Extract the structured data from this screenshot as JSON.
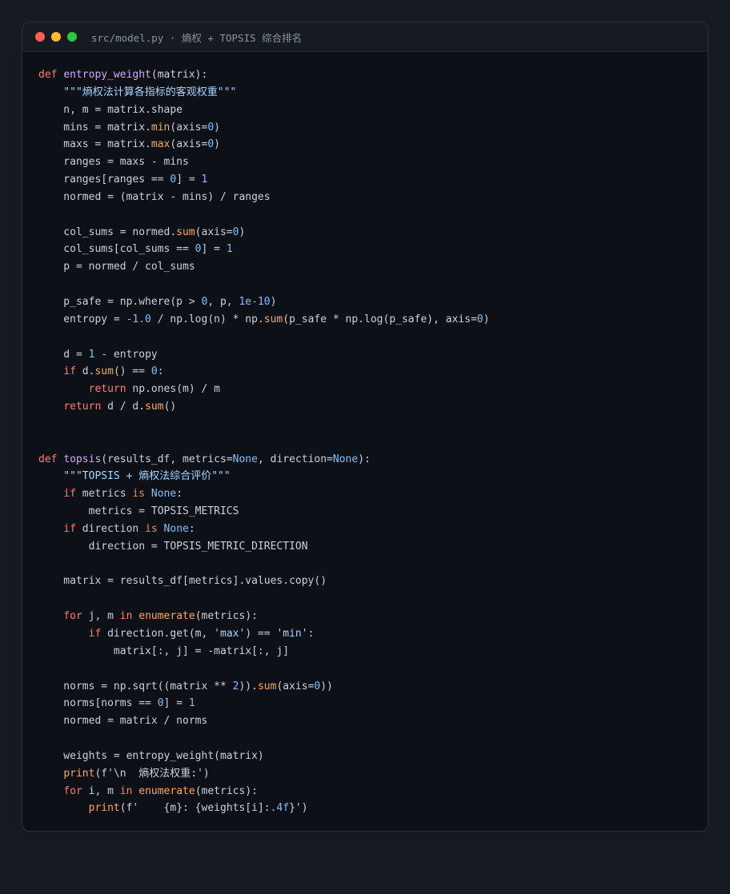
{
  "window": {
    "title": "src/model.py · 熵权 + TOPSIS 综合排名"
  },
  "colors": {
    "keyword": "#ff7b72",
    "function_name": "#d2a8ff",
    "builtin": "#ffa657",
    "number": "#79c0ff",
    "string": "#a5d6ff",
    "text": "#c9d1d9",
    "background": "#0d1117"
  },
  "code": {
    "lines": [
      [
        [
          "kw",
          "def "
        ],
        [
          "fn",
          "entropy_weight"
        ],
        [
          "t",
          "(matrix):"
        ]
      ],
      [
        [
          "str",
          "    \"\"\"熵权法计算各指标的客观权重\"\"\""
        ]
      ],
      [
        [
          "t",
          "    n, m = matrix.shape"
        ]
      ],
      [
        [
          "t",
          "    mins = matrix."
        ],
        [
          "bi",
          "min"
        ],
        [
          "t",
          "(axis="
        ],
        [
          "num",
          "0"
        ],
        [
          "t",
          ")"
        ]
      ],
      [
        [
          "t",
          "    maxs = matrix."
        ],
        [
          "bi",
          "max"
        ],
        [
          "t",
          "(axis="
        ],
        [
          "num",
          "0"
        ],
        [
          "t",
          ")"
        ]
      ],
      [
        [
          "t",
          "    ranges = maxs - mins"
        ]
      ],
      [
        [
          "t",
          "    ranges[ranges == "
        ],
        [
          "num",
          "0"
        ],
        [
          "t",
          "] = "
        ],
        [
          "num",
          "1"
        ]
      ],
      [
        [
          "t",
          "    normed = (matrix - mins) / ranges"
        ]
      ],
      [
        [
          "t",
          ""
        ]
      ],
      [
        [
          "t",
          "    col_sums = normed."
        ],
        [
          "bi",
          "sum"
        ],
        [
          "t",
          "(axis="
        ],
        [
          "num",
          "0"
        ],
        [
          "t",
          ")"
        ]
      ],
      [
        [
          "t",
          "    col_sums[col_sums == "
        ],
        [
          "num",
          "0"
        ],
        [
          "t",
          "] = "
        ],
        [
          "num",
          "1"
        ]
      ],
      [
        [
          "t",
          "    p = normed / col_sums"
        ]
      ],
      [
        [
          "t",
          ""
        ]
      ],
      [
        [
          "t",
          "    p_safe = np.where(p > "
        ],
        [
          "num",
          "0"
        ],
        [
          "t",
          ", p, "
        ],
        [
          "num",
          "1e-10"
        ],
        [
          "t",
          ")"
        ]
      ],
      [
        [
          "t",
          "    entropy = "
        ],
        [
          "num",
          "-1.0"
        ],
        [
          "t",
          " / np.log(n) * np."
        ],
        [
          "bi",
          "sum"
        ],
        [
          "t",
          "(p_safe * np.log(p_safe), axis="
        ],
        [
          "num",
          "0"
        ],
        [
          "t",
          ")"
        ]
      ],
      [
        [
          "t",
          ""
        ]
      ],
      [
        [
          "t",
          "    d = "
        ],
        [
          "num",
          "1"
        ],
        [
          "t",
          " - entropy"
        ]
      ],
      [
        [
          "t",
          "    "
        ],
        [
          "kw",
          "if"
        ],
        [
          "t",
          " d."
        ],
        [
          "bi",
          "sum"
        ],
        [
          "t",
          "() == "
        ],
        [
          "num",
          "0"
        ],
        [
          "t",
          ":"
        ]
      ],
      [
        [
          "t",
          "        "
        ],
        [
          "kw",
          "return"
        ],
        [
          "t",
          " np.ones(m) / m"
        ]
      ],
      [
        [
          "t",
          "    "
        ],
        [
          "kw",
          "return"
        ],
        [
          "t",
          " d / d."
        ],
        [
          "bi",
          "sum"
        ],
        [
          "t",
          "()"
        ]
      ],
      [
        [
          "t",
          ""
        ]
      ],
      [
        [
          "t",
          ""
        ]
      ],
      [
        [
          "kw",
          "def "
        ],
        [
          "fn",
          "topsis"
        ],
        [
          "t",
          "(results_df, metrics="
        ],
        [
          "num",
          "None"
        ],
        [
          "t",
          ", direction="
        ],
        [
          "num",
          "None"
        ],
        [
          "t",
          "):"
        ]
      ],
      [
        [
          "str",
          "    \"\"\"TOPSIS + 熵权法综合评价\"\"\""
        ]
      ],
      [
        [
          "t",
          "    "
        ],
        [
          "kw",
          "if"
        ],
        [
          "t",
          " metrics "
        ],
        [
          "kw",
          "is"
        ],
        [
          "t",
          " "
        ],
        [
          "num",
          "None"
        ],
        [
          "t",
          ":"
        ]
      ],
      [
        [
          "t",
          "        metrics = TOPSIS_METRICS"
        ]
      ],
      [
        [
          "t",
          "    "
        ],
        [
          "kw",
          "if"
        ],
        [
          "t",
          " direction "
        ],
        [
          "kw",
          "is"
        ],
        [
          "t",
          " "
        ],
        [
          "num",
          "None"
        ],
        [
          "t",
          ":"
        ]
      ],
      [
        [
          "t",
          "        direction = TOPSIS_METRIC_DIRECTION"
        ]
      ],
      [
        [
          "t",
          ""
        ]
      ],
      [
        [
          "t",
          "    matrix = results_df[metrics].values.copy()"
        ]
      ],
      [
        [
          "t",
          ""
        ]
      ],
      [
        [
          "t",
          "    "
        ],
        [
          "kw",
          "for"
        ],
        [
          "t",
          " j, m "
        ],
        [
          "kw",
          "in"
        ],
        [
          "t",
          " "
        ],
        [
          "bi",
          "enumerate"
        ],
        [
          "t",
          "(metrics):"
        ]
      ],
      [
        [
          "t",
          "        "
        ],
        [
          "kw",
          "if"
        ],
        [
          "t",
          " direction.get(m, "
        ],
        [
          "str",
          "'max'"
        ],
        [
          "t",
          ") == "
        ],
        [
          "str",
          "'min'"
        ],
        [
          "t",
          ":"
        ]
      ],
      [
        [
          "t",
          "            matrix[:, j] = -matrix[:, j]"
        ]
      ],
      [
        [
          "t",
          ""
        ]
      ],
      [
        [
          "t",
          "    norms = np.sqrt((matrix ** "
        ],
        [
          "num",
          "2"
        ],
        [
          "t",
          "))."
        ],
        [
          "bi",
          "sum"
        ],
        [
          "t",
          "(axis="
        ],
        [
          "num",
          "0"
        ],
        [
          "t",
          "))"
        ]
      ],
      [
        [
          "t",
          "    norms[norms == "
        ],
        [
          "num",
          "0"
        ],
        [
          "t",
          "] = "
        ],
        [
          "num",
          "1"
        ]
      ],
      [
        [
          "t",
          "    normed = matrix / norms"
        ]
      ],
      [
        [
          "t",
          ""
        ]
      ],
      [
        [
          "t",
          "    weights = entropy_weight(matrix)"
        ]
      ],
      [
        [
          "t",
          "    "
        ],
        [
          "bi",
          "print"
        ],
        [
          "t",
          "(f'\\n  熵权法权重:')"
        ]
      ],
      [
        [
          "t",
          "    "
        ],
        [
          "kw",
          "for"
        ],
        [
          "t",
          " i, m "
        ],
        [
          "kw",
          "in"
        ],
        [
          "t",
          " "
        ],
        [
          "bi",
          "enumerate"
        ],
        [
          "t",
          "(metrics):"
        ]
      ],
      [
        [
          "t",
          "        "
        ],
        [
          "bi",
          "print"
        ],
        [
          "t",
          "(f'    {m}: {weights[i]:"
        ],
        [
          "num",
          ".4f"
        ],
        [
          "t",
          "}')"
        ]
      ]
    ]
  }
}
